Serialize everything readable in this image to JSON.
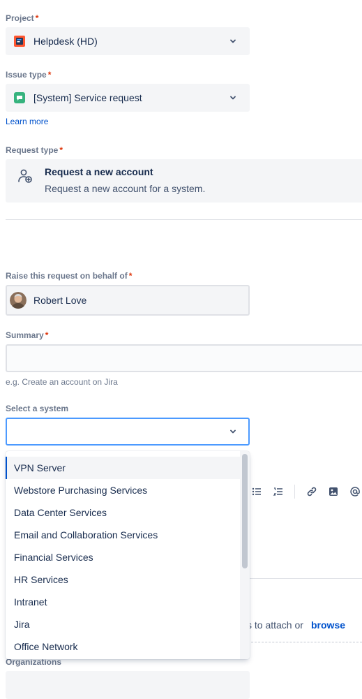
{
  "project": {
    "label": "Project",
    "required_mark": "*",
    "value": "Helpdesk (HD)",
    "icon": "helpdesk-project-icon"
  },
  "issue_type": {
    "label": "Issue type",
    "required_mark": "*",
    "value": "[System] Service request",
    "icon": "service-request-icon",
    "learn_more": "Learn more"
  },
  "request_type": {
    "label": "Request type",
    "required_mark": "*",
    "title": "Request a new account",
    "description": "Request a new account for a system.",
    "icon": "user-add-icon"
  },
  "on_behalf": {
    "label": "Raise this request on behalf of",
    "required_mark": "*",
    "value": "Robert Love"
  },
  "summary": {
    "label": "Summary",
    "required_mark": "*",
    "value": "",
    "hint": "e.g. Create an account on Jira"
  },
  "system": {
    "label": "Select a system",
    "value": "",
    "options": [
      "VPN Server",
      "Webstore Purchasing Services",
      "Data Center Services",
      "Email and Collaboration Services",
      "Financial Services",
      "HR Services",
      "Intranet",
      "Jira",
      "Office Network"
    ]
  },
  "attachment": {
    "text": "s to attach or",
    "browse": "browse"
  },
  "organizations": {
    "label": "Organizations"
  },
  "colors": {
    "accent": "#0052cc",
    "required": "#de350b",
    "field_bg": "#f4f5f7",
    "focus_border": "#4c9aff"
  }
}
